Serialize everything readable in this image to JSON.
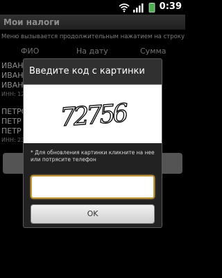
{
  "status_bar": {
    "time": "0:39",
    "icons": [
      "wifi-icon",
      "signal-icon",
      "battery-icon"
    ]
  },
  "app": {
    "title": "Мои налоги",
    "hint": "Меню вызывается продолжительным нажатием на строку таблицы.",
    "columns": [
      "ФИО",
      "На дату",
      "Сумма"
    ],
    "rows": [
      {
        "lines": [
          "ИВАНО",
          "ИВАН",
          "ИВАН"
        ],
        "inn": "ИНН: 123"
      },
      {
        "lines": [
          "ПЕТРО",
          "ПЕТР",
          "ПЕТР"
        ],
        "inn": "ИНН: 234"
      }
    ]
  },
  "dialog": {
    "title": "Введите код с картинки",
    "captcha_text": "72756",
    "note": "* Для обновления картинки кликните на нее или потрясите телефон",
    "input_value": "",
    "ok_label": "OK"
  },
  "colors": {
    "titlebar": "#4a4a4a",
    "input_focus_border": "#c39a3a"
  }
}
